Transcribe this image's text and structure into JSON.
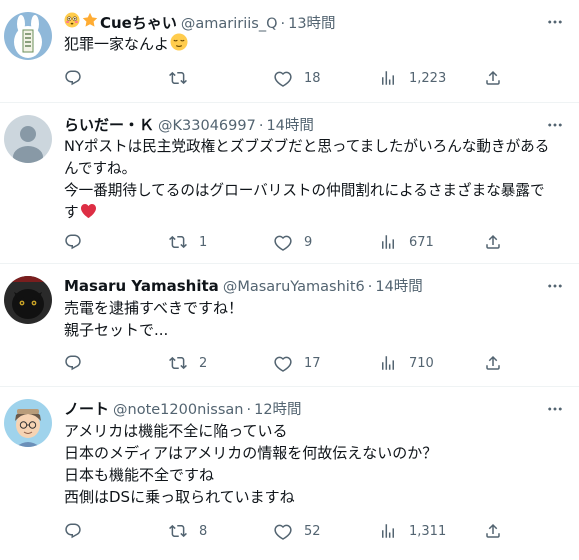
{
  "tweets": [
    {
      "name": "Cueちゃい",
      "handle": "@amaririis_Q",
      "time": "13時間",
      "lines": [
        "犯罪一家なんよ"
      ],
      "replies": "",
      "retweets": "",
      "likes": "18",
      "views": "1,223"
    },
    {
      "name": "らいだー・Ｋ",
      "handle": "@K33046997",
      "time": "14時間",
      "lines": [
        "NYポストは民主党政権とズブズブだと思ってましたがいろんな動きがある",
        "んですね。",
        "今一番期待してるのはグローバリストの仲間割れによるさまざまな暴露で",
        "す"
      ],
      "replies": "",
      "retweets": "1",
      "likes": "9",
      "views": "671"
    },
    {
      "name": "Masaru Yamashita",
      "handle": "@MasaruYamashit6",
      "time": "14時間",
      "lines": [
        "売電を逮捕すべきですね！",
        "親子セットで..."
      ],
      "replies": "",
      "retweets": "2",
      "likes": "17",
      "views": "710"
    },
    {
      "name": "ノート",
      "handle": "@note1200nissan",
      "time": "12時間",
      "lines": [
        "アメリカは機能不全に陥っている",
        "日本のメディアはアメリカの情報を何故伝えないのか？",
        "日本も機能不全ですね",
        "西側はDSに乗っ取られていますね"
      ],
      "replies": "",
      "retweets": "8",
      "likes": "52",
      "views": "1,311"
    }
  ],
  "sep": "·",
  "colors": {
    "text": "#0f1419",
    "muted": "#536471",
    "divider": "#eff3f4",
    "heart": "#e0245e"
  }
}
